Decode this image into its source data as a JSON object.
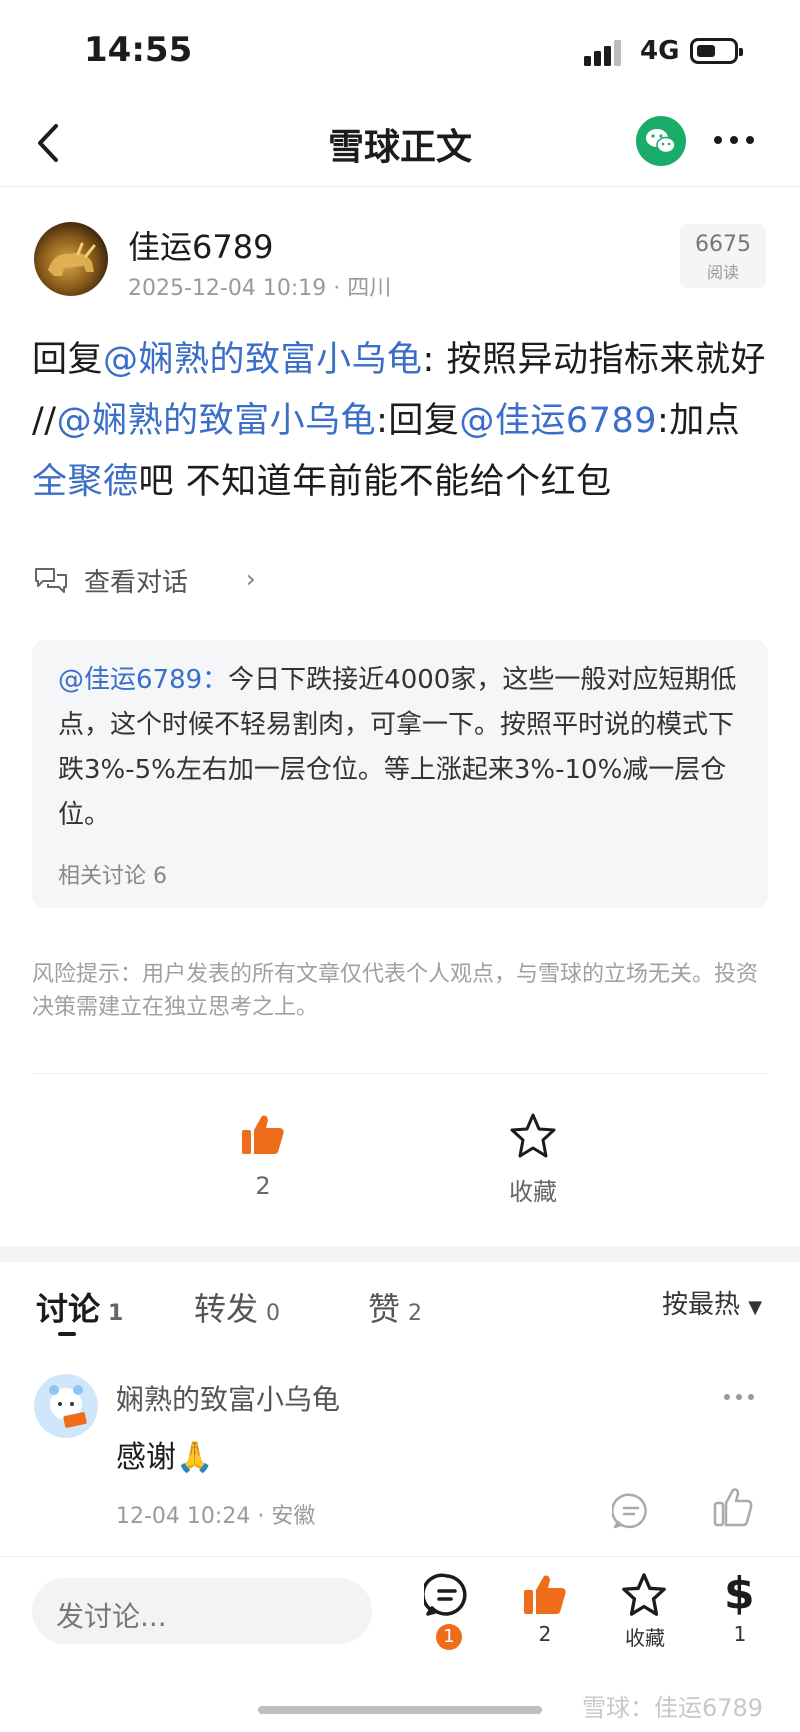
{
  "status_bar": {
    "time": "14:55",
    "network": "4G"
  },
  "nav": {
    "title": "雪球正文"
  },
  "post": {
    "author": "佳运6789",
    "timestamp": "2025-12-04 10:19",
    "location": "四川",
    "reads_count": "6675",
    "reads_label": "阅读",
    "segments": [
      {
        "text": "回复",
        "link": false
      },
      {
        "text": "@娴熟的致富小乌龟",
        "link": true
      },
      {
        "text": ": 按照异动指标来就好 //",
        "link": false
      },
      {
        "text": "@娴熟的致富小乌龟",
        "link": true
      },
      {
        "text": ":回复",
        "link": false
      },
      {
        "text": "@佳运6789",
        "link": true
      },
      {
        "text": ":加点",
        "link": false
      },
      {
        "text": "全聚德",
        "link": true
      },
      {
        "text": "吧 不知道年前能不能给个红包",
        "link": false
      }
    ],
    "view_conversation": "查看对话",
    "quote": {
      "mention": "@佳运6789：",
      "text": "今日下跌接近4000家，这些一般对应短期低点，这个时候不轻易割肉，可拿一下。按照平时说的模式下跌3%-5%左右加一层仓位。等上涨起来3%-10%减一层仓位。",
      "related": "相关讨论 6"
    },
    "risk_notice": "风险提示：用户发表的所有文章仅代表个人观点，与雪球的立场无关。投资决策需建立在独立思考之上。",
    "like_count": "2",
    "favorite_label": "收藏"
  },
  "tabs": [
    {
      "label": "讨论",
      "count": "1",
      "active": true
    },
    {
      "label": "转发",
      "count": "0",
      "active": false
    },
    {
      "label": "赞",
      "count": "2",
      "active": false
    }
  ],
  "sort_label": "按最热",
  "comments": [
    {
      "author": "娴熟的致富小乌龟",
      "text": "感谢🙏",
      "time": "12-04 10:24",
      "location": "安徽"
    }
  ],
  "bottom_bar": {
    "input_placeholder": "发讨论...",
    "comment_badge": "1",
    "like_count": "2",
    "favorite_label": "收藏",
    "reward_count": "1",
    "reward_symbol": "$"
  },
  "watermark": "雪球：佳运6789",
  "colors": {
    "link": "#3a6ec9",
    "accent": "#ef6c1a",
    "wechat": "#1aad6a"
  }
}
